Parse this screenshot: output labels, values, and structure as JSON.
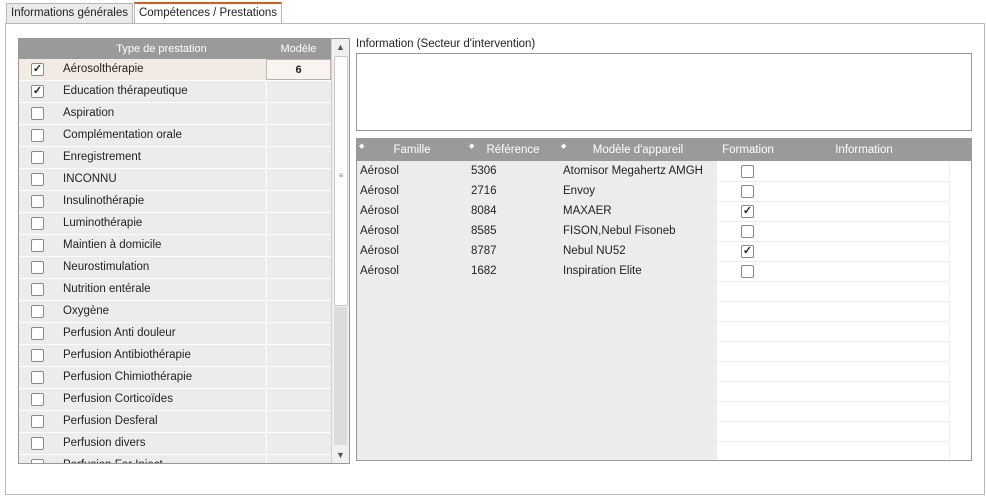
{
  "tabs": [
    {
      "label": "Informations générales",
      "active": false
    },
    {
      "label": "Compétences / Prestations",
      "active": true
    }
  ],
  "prestations": {
    "headers": {
      "type": "Type de prestation",
      "modele": "Modèle"
    },
    "rows": [
      {
        "label": "Aérosolthérapie",
        "checked": true,
        "modele": "6",
        "selected": true
      },
      {
        "label": "Education thérapeutique",
        "checked": true,
        "modele": ""
      },
      {
        "label": "Aspiration",
        "checked": false,
        "modele": ""
      },
      {
        "label": "Complémentation orale",
        "checked": false,
        "modele": ""
      },
      {
        "label": "Enregistrement",
        "checked": false,
        "modele": ""
      },
      {
        "label": "INCONNU",
        "checked": false,
        "modele": ""
      },
      {
        "label": "Insulinothérapie",
        "checked": false,
        "modele": ""
      },
      {
        "label": "Luminothérapie",
        "checked": false,
        "modele": ""
      },
      {
        "label": "Maintien à domicile",
        "checked": false,
        "modele": ""
      },
      {
        "label": "Neurostimulation",
        "checked": false,
        "modele": ""
      },
      {
        "label": "Nutrition entérale",
        "checked": false,
        "modele": ""
      },
      {
        "label": "Oxygène",
        "checked": false,
        "modele": ""
      },
      {
        "label": "Perfusion Anti douleur",
        "checked": false,
        "modele": ""
      },
      {
        "label": "Perfusion Antibiothérapie",
        "checked": false,
        "modele": ""
      },
      {
        "label": "Perfusion Chimiothérapie",
        "checked": false,
        "modele": ""
      },
      {
        "label": "Perfusion Corticoïdes",
        "checked": false,
        "modele": ""
      },
      {
        "label": "Perfusion Desferal",
        "checked": false,
        "modele": ""
      },
      {
        "label": "Perfusion divers",
        "checked": false,
        "modele": ""
      },
      {
        "label": "Perfusion Fer Inject",
        "checked": false,
        "modele": ""
      }
    ]
  },
  "information": {
    "label": "Information (Secteur d'intervention)",
    "value": ""
  },
  "appareils": {
    "headers": {
      "famille": "Famille",
      "reference": "Référence",
      "modele": "Modèle d'appareil",
      "formation": "Formation",
      "information": "Information"
    },
    "rows": [
      {
        "famille": "Aérosol",
        "reference": "5306",
        "modele": "Atomisor Megahertz AMGH",
        "formation": false
      },
      {
        "famille": "Aérosol",
        "reference": "2716",
        "modele": "Envoy",
        "formation": false
      },
      {
        "famille": "Aérosol",
        "reference": "8084",
        "modele": "MAXAER",
        "formation": true
      },
      {
        "famille": "Aérosol",
        "reference": "8585",
        "modele": "FISON,Nebul Fisoneb",
        "formation": false
      },
      {
        "famille": "Aérosol",
        "reference": "8787",
        "modele": "Nebul NU52",
        "formation": true
      },
      {
        "famille": "Aérosol",
        "reference": "1682",
        "modele": "Inspiration Elite",
        "formation": false
      }
    ]
  },
  "colors": {
    "header_bg": "#9a9a9a",
    "tab_accent": "#e05a1b",
    "selected_row": "#f2ebe3"
  }
}
